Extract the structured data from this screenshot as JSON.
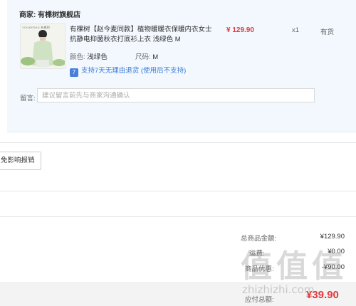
{
  "order": {
    "merchant_label": "商家:",
    "merchant_name": "有棵树旗舰店",
    "product": {
      "thumb_brand": "YOUKESHU 有棵树",
      "title": "有棵树【赵今麦同款】植物暖暖衣保暖内衣女士抗静电抑菌秋衣打底衫上衣 浅绿色 M",
      "price": "¥ 129.90",
      "qty": "x1",
      "stock": "有货",
      "color_label": "颜色:",
      "color_value": "浅绿色",
      "size_label": "尺码:",
      "size_value": "M",
      "return_badge": "7",
      "return_text": "支持7天无理由退货 (使用后不支持)"
    },
    "remark_label": "留言:",
    "remark_placeholder": "建议留言前先与商家沟通确认"
  },
  "invoice_button": "免影响报销",
  "summary": {
    "items_total_label": "总商品金额:",
    "items_total_value": "¥129.90",
    "row2_label": "运费:",
    "row2_value": "¥0.00",
    "row3_label": "商品优惠:",
    "row3_value": "-¥90.00",
    "payable_label": "应付总额:",
    "payable_value": "¥39.90"
  },
  "watermark": {
    "text": "值值值",
    "url": "zhizhizhi.com"
  },
  "colors": {
    "accent_red": "#e4393c",
    "panel_bg": "#f2f8fe",
    "link_blue": "#3a7bd5"
  }
}
